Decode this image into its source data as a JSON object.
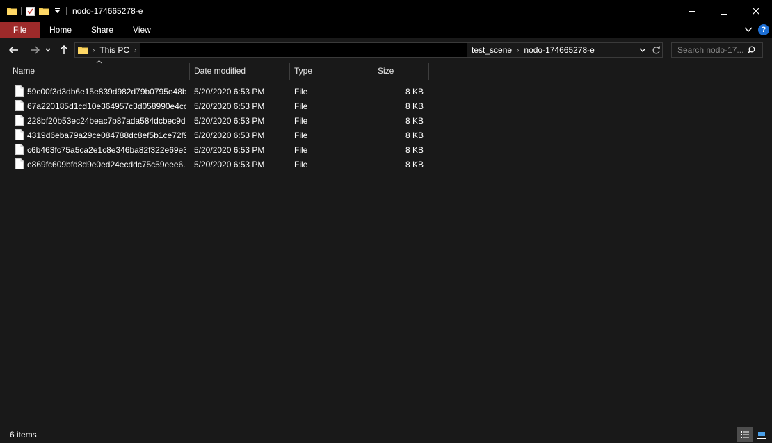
{
  "window": {
    "title": "nodo-174665278-e"
  },
  "ribbon": {
    "tabs": [
      "File",
      "Home",
      "Share",
      "View"
    ],
    "help": "?"
  },
  "address": {
    "root": "This PC",
    "right_crumbs": [
      "test_scene",
      "nodo-174665278-e"
    ]
  },
  "search": {
    "placeholder": "Search nodo-17..."
  },
  "columns": [
    "Name",
    "Date modified",
    "Type",
    "Size"
  ],
  "files": [
    {
      "name": "59c00f3d3db6e15e839d982d79b0795e48b...",
      "date": "5/20/2020 6:53 PM",
      "type": "File",
      "size": "8 KB"
    },
    {
      "name": "67a220185d1cd10e364957c3d058990e4cc...",
      "date": "5/20/2020 6:53 PM",
      "type": "File",
      "size": "8 KB"
    },
    {
      "name": "228bf20b53ec24beac7b87ada584dcbec9d...",
      "date": "5/20/2020 6:53 PM",
      "type": "File",
      "size": "8 KB"
    },
    {
      "name": "4319d6eba79a29ce084788dc8ef5b1ce72f9...",
      "date": "5/20/2020 6:53 PM",
      "type": "File",
      "size": "8 KB"
    },
    {
      "name": "c6b463fc75a5ca2e1c8e346ba82f322e69e3...",
      "date": "5/20/2020 6:53 PM",
      "type": "File",
      "size": "8 KB"
    },
    {
      "name": "e869fc609bfd8d9e0ed24ecddc75c59eee6...",
      "date": "5/20/2020 6:53 PM",
      "type": "File",
      "size": "8 KB"
    }
  ],
  "status": {
    "item_count": "6 items"
  },
  "colors": {
    "file_tab": "#9d2a2a",
    "background": "#191919",
    "chrome": "#000000",
    "folder": "#f2c94c",
    "help": "#1c6ed4"
  }
}
